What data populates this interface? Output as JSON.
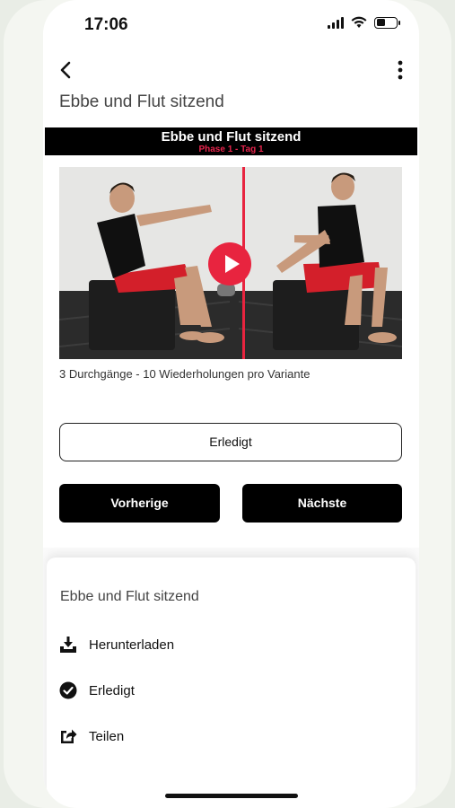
{
  "status_bar": {
    "time": "17:06",
    "battery_level": 0.45
  },
  "header": {
    "title": "Ebbe und Flut sitzend"
  },
  "banner": {
    "title": "Ebbe und Flut sitzend",
    "subtitle": "Phase 1 - Tag 1",
    "subtitle_color": "#e8244d"
  },
  "exercise": {
    "reps": "3 Durchgänge - 10 Wiederholungen pro Variante"
  },
  "actions": {
    "done_label": "Erledigt",
    "prev_label": "Vorherige",
    "next_label": "Nächste"
  },
  "sheet": {
    "title": "Ebbe und Flut sitzend",
    "items": [
      {
        "label": "Herunterladen",
        "icon": "download-icon"
      },
      {
        "label": "Erledigt",
        "icon": "check-circle-icon"
      },
      {
        "label": "Teilen",
        "icon": "share-icon"
      }
    ]
  },
  "colors": {
    "accent": "#e8243f",
    "button_dark": "#000000"
  }
}
